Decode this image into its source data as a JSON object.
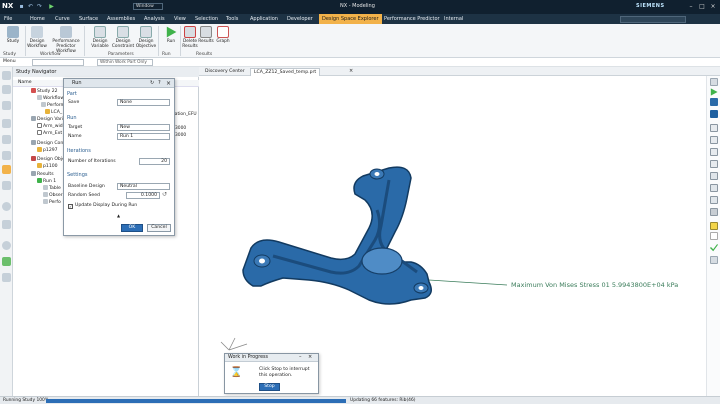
{
  "titlebar": {
    "app_logo": "NX",
    "window_title": "NX - Modeling",
    "brand": "SIEMENS",
    "window_menu": "Window"
  },
  "ribbon_tabs": [
    "File",
    "Home",
    "Curve",
    "Surface",
    "Assemblies",
    "Analysis",
    "View",
    "Selection",
    "Tools",
    "Application",
    "Developer",
    "Design Space Explorer",
    "Performance Predictor",
    "Internal"
  ],
  "active_ribbon_tab": "Design Space Explorer",
  "ribbon": {
    "buttons": [
      "Study",
      "Design Workflow",
      "Performance Predictor Workflow",
      "Design Variable",
      "Design Constraint",
      "Design Objective",
      "Run",
      "Delete Results",
      "Results",
      "Graph"
    ],
    "groups": [
      "Study",
      "Workflow",
      "Parameters",
      "Run",
      "Results"
    ]
  },
  "toolbar2": {
    "menu_label": "Menu",
    "filter_text": "Within Work Part Only"
  },
  "navigator": {
    "title": "Study Navigator",
    "column_name": "Name",
    "column_extra": "ration_EFU",
    "values": [
      "3000",
      "3000"
    ],
    "rows": [
      "Study 22",
      "Workflow",
      "Performa",
      "LCA_",
      "Design Varia",
      "Arm_wid",
      "Arm_Ext",
      "Design Cons",
      "p1297",
      "Design Obje",
      "p1100",
      "Results",
      "Run 1",
      "Table",
      "Obser",
      "Perfo"
    ]
  },
  "dialog": {
    "title": "Run",
    "sections": {
      "part": "Part",
      "run": "Run",
      "iterations": "Iterations",
      "settings": "Settings"
    },
    "save_label": "Save",
    "save_value": "None",
    "target_label": "Target",
    "target_value": "New",
    "name_label": "Name",
    "name_value": "Run 1",
    "iterations_label": "Number of Iterations",
    "iterations_value": "20",
    "baseline_label": "Baseline Design",
    "baseline_value": "Neutral",
    "seed_label": "Random Seed",
    "seed_value": "0.1000",
    "update_label": "Update Display During Run",
    "ok_label": "OK",
    "cancel_label": "Cancel"
  },
  "doc_tabs": [
    "Discovery Center",
    "LCA_ZZ12_Saved_temp.prt"
  ],
  "annotation": "Maximum  Von Mises Stress 01 5.9943800E+04 kPa",
  "wip": {
    "title": "Work in Progress",
    "message": "Click Stop to interrupt this operation.",
    "stop_label": "Stop"
  },
  "statusbar": {
    "left": "Running Study 100%",
    "right": "Updating 66 features: Rib(46)"
  },
  "colors": {
    "title_bg": "#10202f",
    "ribbon_tab_bg": "#1d3244",
    "active_tab": "#f2b24a",
    "part_blue": "#2a6aa8"
  }
}
